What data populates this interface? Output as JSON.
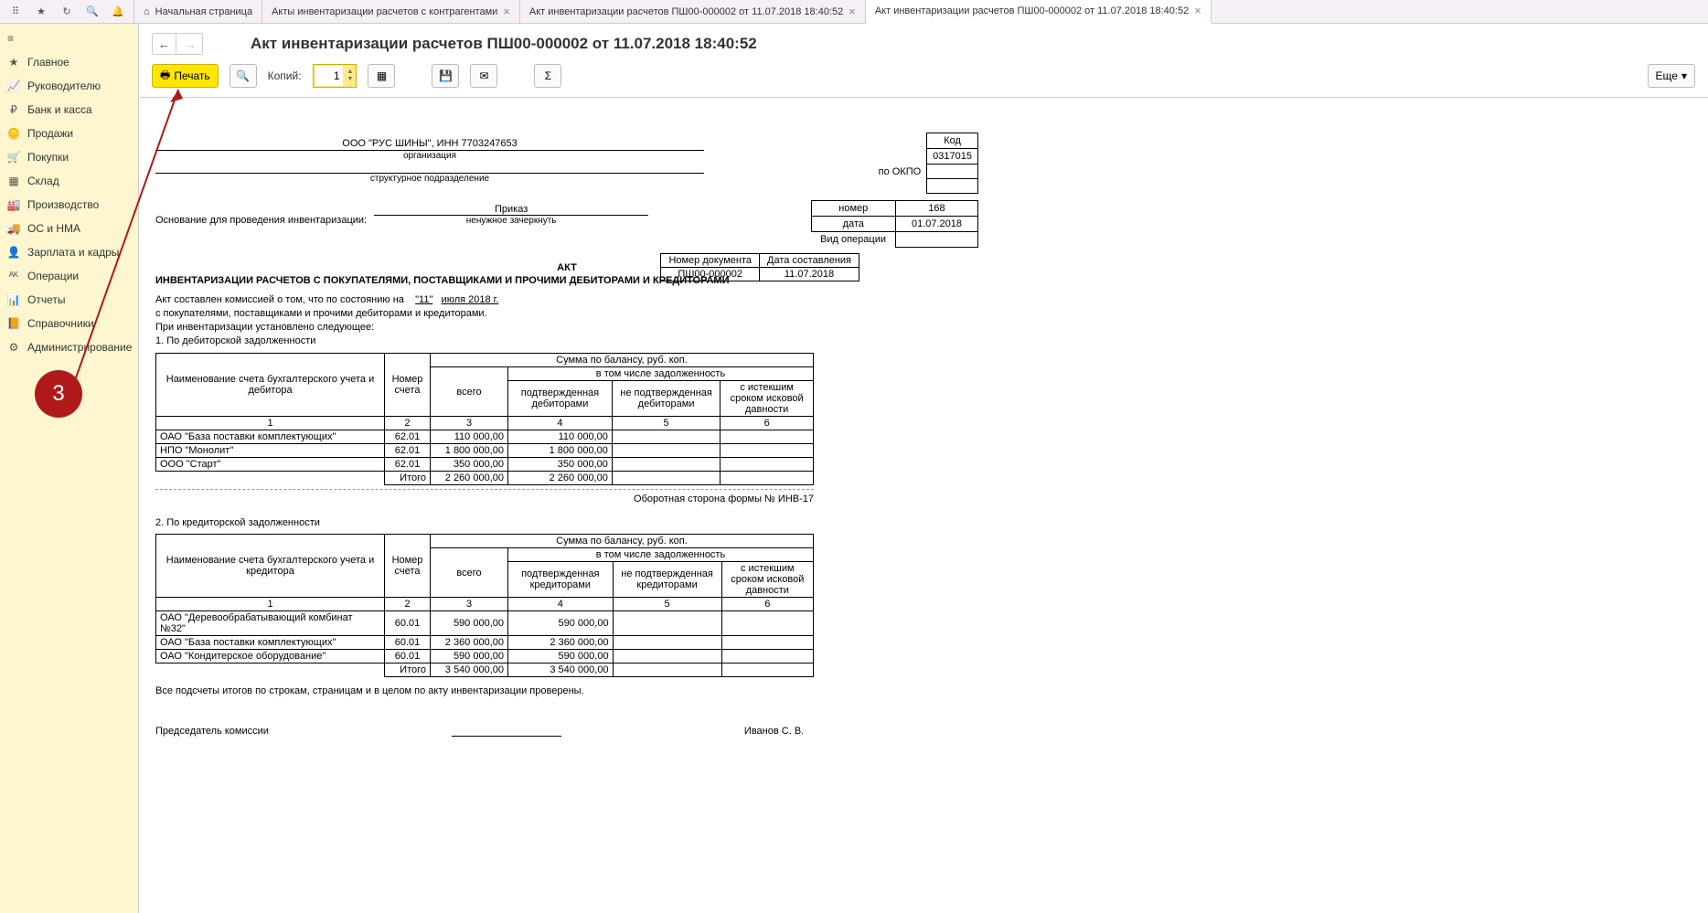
{
  "topbar": {
    "tabs": [
      {
        "label": "Начальная страница",
        "closable": false,
        "home": true
      },
      {
        "label": "Акты инвентаризации расчетов с контрагентами",
        "closable": true
      },
      {
        "label": "Акт инвентаризации расчетов ПШ00-000002 от 11.07.2018 18:40:52",
        "closable": true
      },
      {
        "label": "Акт инвентаризации расчетов ПШ00-000002 от 11.07.2018 18:40:52",
        "closable": true,
        "active": true
      }
    ]
  },
  "sidebar": {
    "items": [
      {
        "label": "Главное"
      },
      {
        "label": "Руководителю"
      },
      {
        "label": "Банк и касса"
      },
      {
        "label": "Продажи"
      },
      {
        "label": "Покупки"
      },
      {
        "label": "Склад"
      },
      {
        "label": "Производство"
      },
      {
        "label": "ОС и НМА"
      },
      {
        "label": "Зарплата и кадры"
      },
      {
        "label": "Операции"
      },
      {
        "label": "Отчеты"
      },
      {
        "label": "Справочники"
      },
      {
        "label": "Администрирование"
      }
    ]
  },
  "page": {
    "title": "Акт инвентаризации расчетов ПШ00-000002 от 11.07.2018 18:40:52",
    "print_label": "Печать",
    "copies_label": "Копий:",
    "copies_value": "1",
    "more_label": "Еще"
  },
  "doc": {
    "org": "ООО \"РУС ШИНЫ\", ИНН 7703247653",
    "org_sub": "организация",
    "subdiv_sub": "структурное подразделение",
    "okpo_label": "по ОКПО",
    "code_hdr": "Код",
    "code_val": "0317015",
    "basis_label": "Основание для проведения инвентаризации:",
    "basis_value": "Приказ",
    "basis_sub": "ненужное зачеркнуть",
    "number_label": "номер",
    "number_value": "168",
    "date_label": "дата",
    "date_value": "01.07.2018",
    "vid_label": "Вид операции",
    "akt": "АКТ",
    "docnum_hdr": "Номер документа",
    "docdate_hdr": "Дата составления",
    "docnum": "ПШ00-000002",
    "docdate": "11.07.2018",
    "title2": "ИНВЕНТАРИЗАЦИИ РАСЧЕТОВ С ПОКУПАТЕЛЯМИ, ПОСТАВЩИКАМИ И ПРОЧИМИ ДЕБИТОРАМИ И КРЕДИТОРАМИ",
    "para1_a": "Акт составлен комиссией о том, что по состоянию на",
    "para1_day": "\"11\"",
    "para1_month": "июля 2018 г.",
    "para1_b": "с покупателями, поставщиками и прочими дебиторами и кредиторами.",
    "para1_c": "При инвентаризации установлено следующее:",
    "sec1": "1.  По дебиторской задолженности",
    "sec2": "2.  По кредиторской задолженности",
    "tbl_hdr": {
      "name_deb": "Наименование счета бухгалтерского учета и дебитора",
      "name_cred": "Наименование счета бухгалтерского учета и кредитора",
      "acc": "Номер счета",
      "sum": "Сумма по балансу, руб. коп.",
      "total": "всего",
      "incl": "в том числе задолженность",
      "conf_deb": "подтвержденная дебиторами",
      "unconf_deb": "не подтвержденная дебиторами",
      "conf_cred": "подтвержденная кредиторами",
      "unconf_cred": "не подтвержденная кредиторами",
      "expired": "с истекшим сроком исковой давности",
      "c1": "1",
      "c2": "2",
      "c3": "3",
      "c4": "4",
      "c5": "5",
      "c6": "6",
      "itogo": "Итого"
    },
    "deb_rows": [
      {
        "name": "ОАО \"База поставки комплектующих\"",
        "acc": "62.01",
        "total": "110 000,00",
        "conf": "110 000,00"
      },
      {
        "name": "НПО \"Монолит\"",
        "acc": "62.01",
        "total": "1 800 000,00",
        "conf": "1 800 000,00"
      },
      {
        "name": "ООО \"Старт\"",
        "acc": "62.01",
        "total": "350 000,00",
        "conf": "350 000,00"
      }
    ],
    "deb_total": {
      "total": "2 260 000,00",
      "conf": "2 260 000,00"
    },
    "cred_rows": [
      {
        "name": "ОАО \"Деревообрабатывающий комбинат №32\"",
        "acc": "60.01",
        "total": "590 000,00",
        "conf": "590 000,00"
      },
      {
        "name": "ОАО \"База поставки комплектующих\"",
        "acc": "60.01",
        "total": "2 360 000,00",
        "conf": "2 360 000,00"
      },
      {
        "name": "ОАО \"Кондитерское оборудование\"",
        "acc": "60.01",
        "total": "590 000,00",
        "conf": "590 000,00"
      }
    ],
    "cred_total": {
      "total": "3 540 000,00",
      "conf": "3 540 000,00"
    },
    "form_note": "Оборотная сторона формы № ИНВ-17",
    "checked": "Все подсчеты итогов по строкам, страницам и в целом по акту инвентаризации проверены.",
    "chairman": "Председатель комиссии",
    "chairman_name": "Иванов С. В."
  },
  "annotation": {
    "num": "3"
  }
}
